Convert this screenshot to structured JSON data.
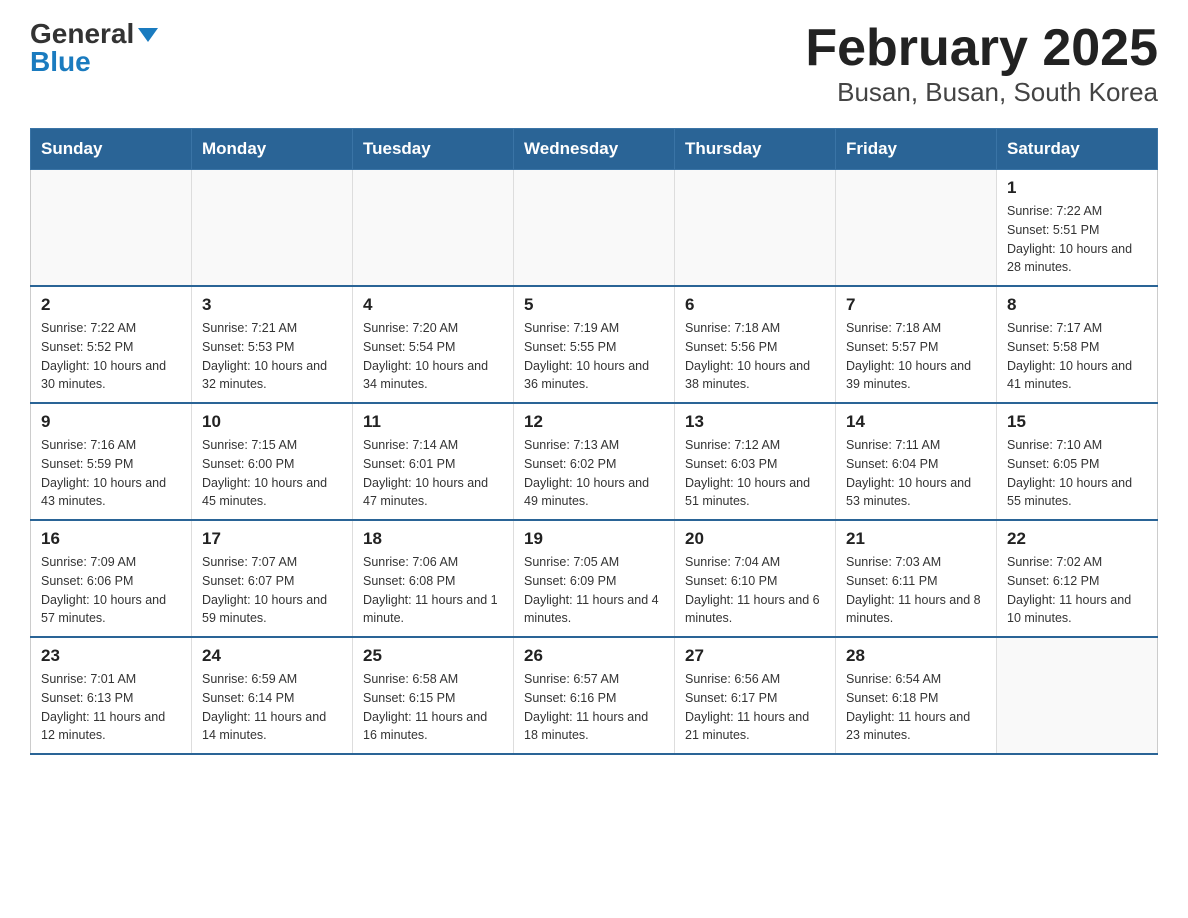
{
  "header": {
    "logo_general": "General",
    "logo_blue": "Blue",
    "title": "February 2025",
    "subtitle": "Busan, Busan, South Korea"
  },
  "days_of_week": [
    "Sunday",
    "Monday",
    "Tuesday",
    "Wednesday",
    "Thursday",
    "Friday",
    "Saturday"
  ],
  "weeks": [
    [
      {
        "day": "",
        "info": ""
      },
      {
        "day": "",
        "info": ""
      },
      {
        "day": "",
        "info": ""
      },
      {
        "day": "",
        "info": ""
      },
      {
        "day": "",
        "info": ""
      },
      {
        "day": "",
        "info": ""
      },
      {
        "day": "1",
        "info": "Sunrise: 7:22 AM\nSunset: 5:51 PM\nDaylight: 10 hours and 28 minutes."
      }
    ],
    [
      {
        "day": "2",
        "info": "Sunrise: 7:22 AM\nSunset: 5:52 PM\nDaylight: 10 hours and 30 minutes."
      },
      {
        "day": "3",
        "info": "Sunrise: 7:21 AM\nSunset: 5:53 PM\nDaylight: 10 hours and 32 minutes."
      },
      {
        "day": "4",
        "info": "Sunrise: 7:20 AM\nSunset: 5:54 PM\nDaylight: 10 hours and 34 minutes."
      },
      {
        "day": "5",
        "info": "Sunrise: 7:19 AM\nSunset: 5:55 PM\nDaylight: 10 hours and 36 minutes."
      },
      {
        "day": "6",
        "info": "Sunrise: 7:18 AM\nSunset: 5:56 PM\nDaylight: 10 hours and 38 minutes."
      },
      {
        "day": "7",
        "info": "Sunrise: 7:18 AM\nSunset: 5:57 PM\nDaylight: 10 hours and 39 minutes."
      },
      {
        "day": "8",
        "info": "Sunrise: 7:17 AM\nSunset: 5:58 PM\nDaylight: 10 hours and 41 minutes."
      }
    ],
    [
      {
        "day": "9",
        "info": "Sunrise: 7:16 AM\nSunset: 5:59 PM\nDaylight: 10 hours and 43 minutes."
      },
      {
        "day": "10",
        "info": "Sunrise: 7:15 AM\nSunset: 6:00 PM\nDaylight: 10 hours and 45 minutes."
      },
      {
        "day": "11",
        "info": "Sunrise: 7:14 AM\nSunset: 6:01 PM\nDaylight: 10 hours and 47 minutes."
      },
      {
        "day": "12",
        "info": "Sunrise: 7:13 AM\nSunset: 6:02 PM\nDaylight: 10 hours and 49 minutes."
      },
      {
        "day": "13",
        "info": "Sunrise: 7:12 AM\nSunset: 6:03 PM\nDaylight: 10 hours and 51 minutes."
      },
      {
        "day": "14",
        "info": "Sunrise: 7:11 AM\nSunset: 6:04 PM\nDaylight: 10 hours and 53 minutes."
      },
      {
        "day": "15",
        "info": "Sunrise: 7:10 AM\nSunset: 6:05 PM\nDaylight: 10 hours and 55 minutes."
      }
    ],
    [
      {
        "day": "16",
        "info": "Sunrise: 7:09 AM\nSunset: 6:06 PM\nDaylight: 10 hours and 57 minutes."
      },
      {
        "day": "17",
        "info": "Sunrise: 7:07 AM\nSunset: 6:07 PM\nDaylight: 10 hours and 59 minutes."
      },
      {
        "day": "18",
        "info": "Sunrise: 7:06 AM\nSunset: 6:08 PM\nDaylight: 11 hours and 1 minute."
      },
      {
        "day": "19",
        "info": "Sunrise: 7:05 AM\nSunset: 6:09 PM\nDaylight: 11 hours and 4 minutes."
      },
      {
        "day": "20",
        "info": "Sunrise: 7:04 AM\nSunset: 6:10 PM\nDaylight: 11 hours and 6 minutes."
      },
      {
        "day": "21",
        "info": "Sunrise: 7:03 AM\nSunset: 6:11 PM\nDaylight: 11 hours and 8 minutes."
      },
      {
        "day": "22",
        "info": "Sunrise: 7:02 AM\nSunset: 6:12 PM\nDaylight: 11 hours and 10 minutes."
      }
    ],
    [
      {
        "day": "23",
        "info": "Sunrise: 7:01 AM\nSunset: 6:13 PM\nDaylight: 11 hours and 12 minutes."
      },
      {
        "day": "24",
        "info": "Sunrise: 6:59 AM\nSunset: 6:14 PM\nDaylight: 11 hours and 14 minutes."
      },
      {
        "day": "25",
        "info": "Sunrise: 6:58 AM\nSunset: 6:15 PM\nDaylight: 11 hours and 16 minutes."
      },
      {
        "day": "26",
        "info": "Sunrise: 6:57 AM\nSunset: 6:16 PM\nDaylight: 11 hours and 18 minutes."
      },
      {
        "day": "27",
        "info": "Sunrise: 6:56 AM\nSunset: 6:17 PM\nDaylight: 11 hours and 21 minutes."
      },
      {
        "day": "28",
        "info": "Sunrise: 6:54 AM\nSunset: 6:18 PM\nDaylight: 11 hours and 23 minutes."
      },
      {
        "day": "",
        "info": ""
      }
    ]
  ]
}
